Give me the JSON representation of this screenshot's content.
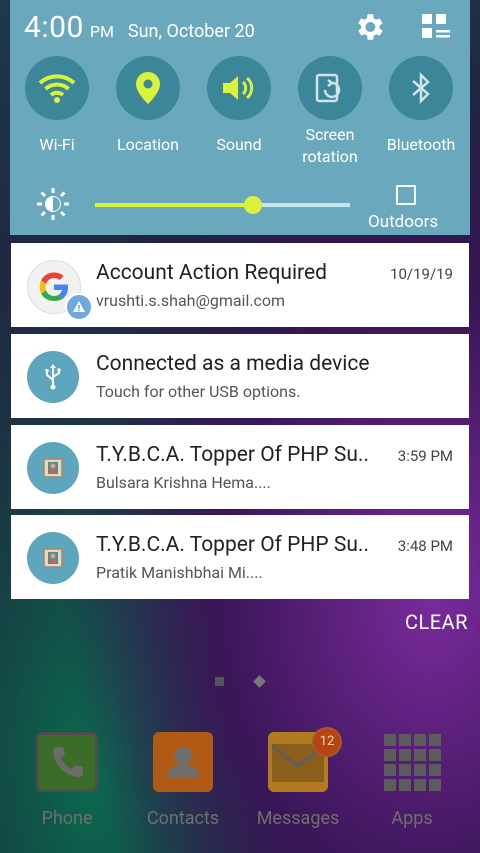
{
  "status": {
    "time": "4:00",
    "ampm": "PM",
    "date": "Sun, October 20"
  },
  "toggles": [
    {
      "label": "Wi-Fi",
      "icon": "wifi-icon",
      "active": true
    },
    {
      "label": "Location",
      "icon": "location-icon",
      "active": true
    },
    {
      "label": "Sound",
      "icon": "sound-icon",
      "active": true
    },
    {
      "label": "Screen\nrotation",
      "icon": "rotation-icon",
      "active": false
    },
    {
      "label": "Bluetooth",
      "icon": "bluetooth-icon",
      "active": false
    }
  ],
  "brightness": {
    "level": 0.62,
    "outdoors_label": "Outdoors"
  },
  "notifications": [
    {
      "title": "Account Action Required",
      "subtitle": "vrushti.s.shah@gmail.com",
      "time": "10/19/19",
      "icon": "google-icon"
    },
    {
      "title": "Connected as a media device",
      "subtitle": "Touch for other USB options.",
      "time": "",
      "icon": "usb-icon"
    },
    {
      "title": "T.Y.B.C.A. Topper Of PHP Su..",
      "subtitle": "Bulsara Krishna Hema....",
      "time": "3:59 PM",
      "icon": "app-icon"
    },
    {
      "title": "T.Y.B.C.A. Topper Of PHP Su..",
      "subtitle": "Pratik Manishbhai Mi....",
      "time": "3:48 PM",
      "icon": "app-icon"
    }
  ],
  "clear_label": "CLEAR",
  "dock": [
    {
      "label": "Phone"
    },
    {
      "label": "Contacts"
    },
    {
      "label": "Messages",
      "badge": "12"
    },
    {
      "label": "Apps"
    }
  ],
  "colors": {
    "panel": "#6aa9bd",
    "toggle_active": "#d9f23a",
    "toggle_bg": "#3b8699",
    "notif_icon_bg": "#5ea6bd"
  }
}
